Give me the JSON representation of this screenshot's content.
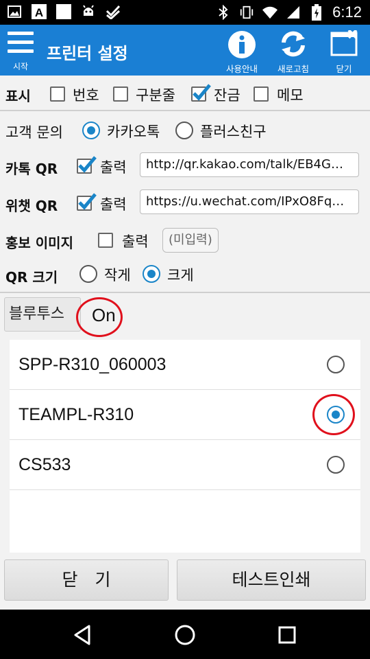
{
  "status_bar": {
    "time": "6:12",
    "left_icons": [
      "image-icon",
      "a-icon",
      "square-icon",
      "android-icon",
      "check-app-icon"
    ],
    "right_icons": [
      "bluetooth-icon",
      "vibrate-icon",
      "wifi-icon",
      "signal-icon",
      "battery-charging-icon"
    ]
  },
  "app_bar": {
    "menu_label": "시작",
    "title": "프린터 설정",
    "actions": [
      {
        "icon": "info-icon",
        "label": "사용안내"
      },
      {
        "icon": "refresh-icon",
        "label": "새로고침"
      },
      {
        "icon": "close-window-icon",
        "label": "닫기"
      }
    ],
    "color": "#1a7fd4"
  },
  "display_row": {
    "label": "표시",
    "options": [
      {
        "label": "번호",
        "checked": false
      },
      {
        "label": "구분줄",
        "checked": false
      },
      {
        "label": "잔금",
        "checked": true
      },
      {
        "label": "메모",
        "checked": false
      }
    ]
  },
  "contact_row": {
    "label": "고객 문의",
    "options": [
      {
        "label": "카카오톡",
        "selected": true
      },
      {
        "label": "플러스친구",
        "selected": false
      }
    ]
  },
  "kakao_qr": {
    "label": "카톡 QR",
    "checkbox_label": "출력",
    "checked": true,
    "url": "http://qr.kakao.com/talk/EB4G…"
  },
  "wechat_qr": {
    "label": "위챗 QR",
    "checkbox_label": "출력",
    "checked": true,
    "url": "https://u.wechat.com/IPxO8Fq…"
  },
  "promo_image": {
    "label": "홍보 이미지",
    "checkbox_label": "출력",
    "checked": false,
    "button_label": "(미입력)"
  },
  "qr_size": {
    "label": "QR 크기",
    "options": [
      {
        "label": "작게",
        "selected": false
      },
      {
        "label": "크게",
        "selected": true
      }
    ]
  },
  "bluetooth": {
    "button_label": "블루투스",
    "state": "On"
  },
  "devices": [
    {
      "name": "SPP-R310_060003",
      "selected": false
    },
    {
      "name": "TEAMPL-R310",
      "selected": true
    },
    {
      "name": "CS533",
      "selected": false
    }
  ],
  "buttons": {
    "close": "닫　기",
    "test_print": "테스트인쇄"
  },
  "accent_color": "#1a85c8",
  "highlight_color": "#e0101c"
}
